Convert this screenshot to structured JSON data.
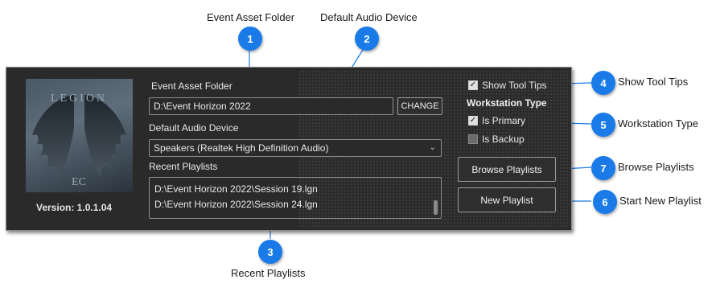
{
  "callouts": {
    "c1": {
      "number": "1",
      "label": "Event Asset Folder"
    },
    "c2": {
      "number": "2",
      "label": "Default Audio Device"
    },
    "c3": {
      "number": "3",
      "label": "Recent Playlists"
    },
    "c4": {
      "number": "4",
      "label": "Show Tool Tips"
    },
    "c5": {
      "number": "5",
      "label": "Workstation Type"
    },
    "c6": {
      "number": "6",
      "label": "Start New Playlist"
    },
    "c7": {
      "number": "7",
      "label": "Browse Playlists"
    }
  },
  "logo": {
    "text": "LEGION EC"
  },
  "app": {
    "version": "Version: 1.0.1.04"
  },
  "asset_folder": {
    "label": "Event Asset Folder",
    "value": "D:\\Event Horizon 2022",
    "change_label": "CHANGE"
  },
  "audio": {
    "label": "Default Audio Device",
    "selected": "Speakers (Realtek High Definition Audio)"
  },
  "recent": {
    "label": "Recent Playlists",
    "items": [
      "D:\\Event Horizon 2022\\Session 19.lgn",
      "D:\\Event Horizon 2022\\Session 24.lgn"
    ]
  },
  "options": {
    "show_tool_tips": {
      "label": "Show Tool Tips",
      "checked": true
    }
  },
  "workstation": {
    "heading": "Workstation Type",
    "primary": {
      "label": "Is Primary",
      "checked": true
    },
    "backup": {
      "label": "Is Backup",
      "checked": false
    }
  },
  "buttons": {
    "browse": "Browse Playlists",
    "new_playlist": "New Playlist"
  },
  "colors": {
    "badge": "#1a7be8",
    "panel": "#2a2a2a"
  }
}
